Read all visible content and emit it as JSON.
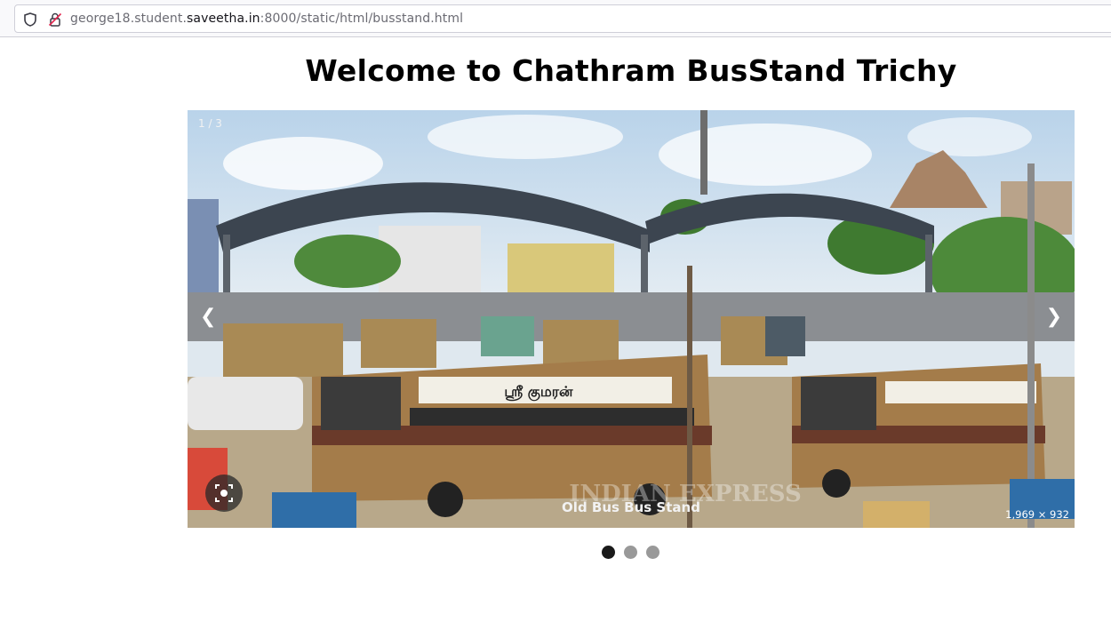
{
  "browser": {
    "url_prefix": "george18.student.",
    "url_domain": "saveetha.in",
    "url_suffix": ":8000/static/html/busstand.html"
  },
  "page": {
    "title": "Welcome to Chathram BusStand Trichy"
  },
  "slideshow": {
    "counter": "1 / 3",
    "prev_label": "❮",
    "next_label": "❯",
    "caption": "Old Bus Bus Stand",
    "image_dimensions": "1,969 × 932",
    "watermark": "INDIAN EXPRESS",
    "bus_sign": "ஸ்ரீ குமரன்",
    "total_slides": 3,
    "active_slide": 1
  },
  "colors": {
    "dot_active": "#1a1a1a",
    "dot_inactive": "#999999",
    "bus_body": "#a47c4a",
    "bus_stripe": "#6a3a2a",
    "canopy": "#3c4550"
  }
}
